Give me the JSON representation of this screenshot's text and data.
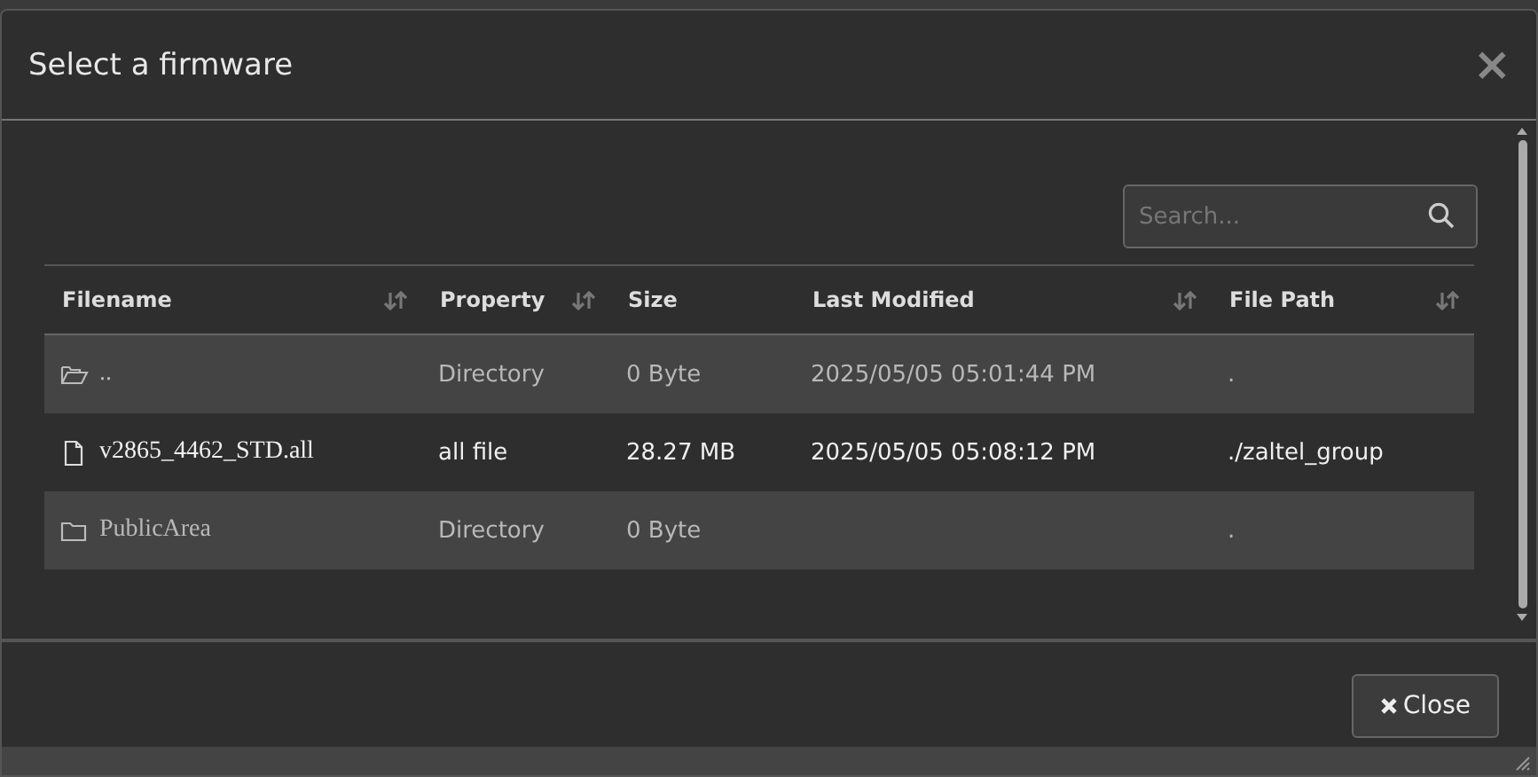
{
  "dialog": {
    "title": "Select a firmware",
    "close_symbol": "×"
  },
  "search": {
    "placeholder": "Search..."
  },
  "table": {
    "columns": [
      {
        "label": "Filename",
        "sortable": true
      },
      {
        "label": "Property",
        "sortable": true
      },
      {
        "label": "Size",
        "sortable": false
      },
      {
        "label": "Last Modified",
        "sortable": true
      },
      {
        "label": "File Path",
        "sortable": true
      }
    ],
    "rows": [
      {
        "kind": "parent",
        "cells": [
          "..",
          "Directory",
          "0 Byte",
          "2025/05/05 05:01:44 PM",
          "."
        ]
      },
      {
        "kind": "file",
        "cells": [
          "v2865_4462_STD.all",
          "all file",
          "28.27 MB",
          "2025/05/05 05:08:12 PM",
          "./zaltel_group"
        ]
      },
      {
        "kind": "folder",
        "cells": [
          "PublicArea",
          "Directory",
          "0 Byte",
          "",
          "."
        ]
      }
    ]
  },
  "footer": {
    "button": "Close"
  }
}
